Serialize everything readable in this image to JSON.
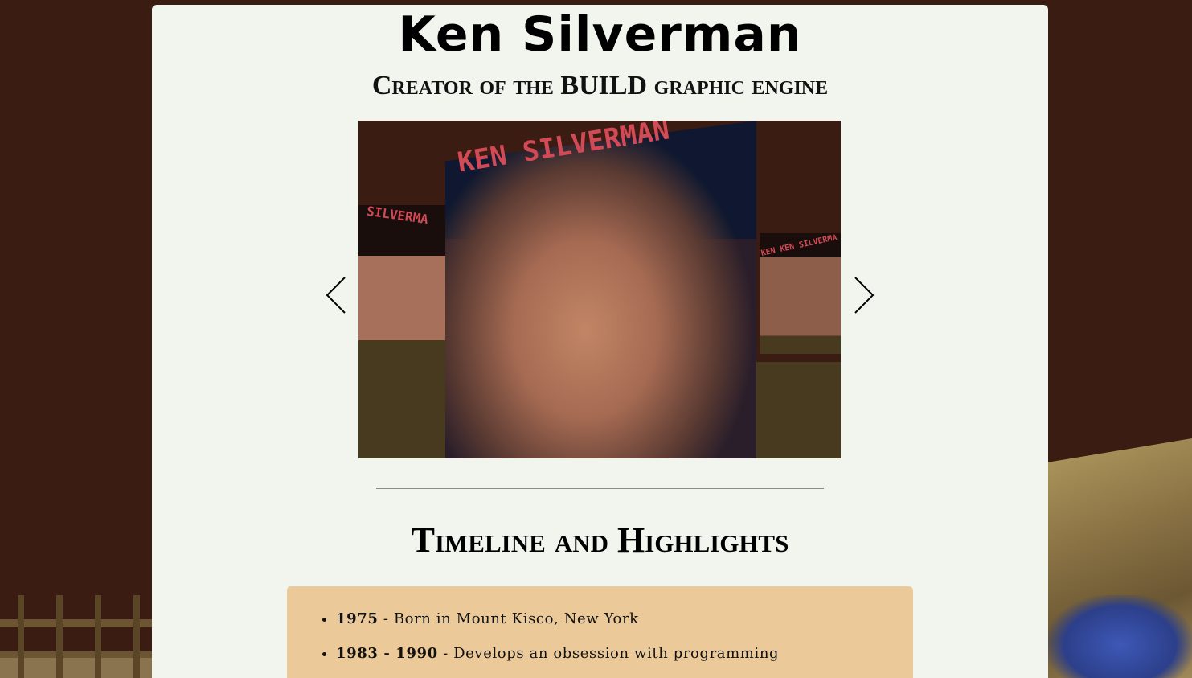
{
  "header": {
    "title": "Ken Silverman",
    "subtitle": "Creator of the BUILD graphic engine"
  },
  "carousel": {
    "image_alt": "Ken Silverman portrait rendered in the BUILD engine",
    "main_label": "KEN SILVERMAN",
    "left_label": "SILVERMA",
    "right_label": "KEN KEN SILVERMA",
    "prev_icon": "chevron-left-icon",
    "next_icon": "chevron-right-icon"
  },
  "timeline": {
    "heading": "Timeline and Highlights",
    "items": [
      {
        "year": "1975",
        "text": " - Born in Mount Kisco, New York"
      },
      {
        "year": "1983 - 1990",
        "text": " - Develops an obsession with programming"
      }
    ]
  }
}
